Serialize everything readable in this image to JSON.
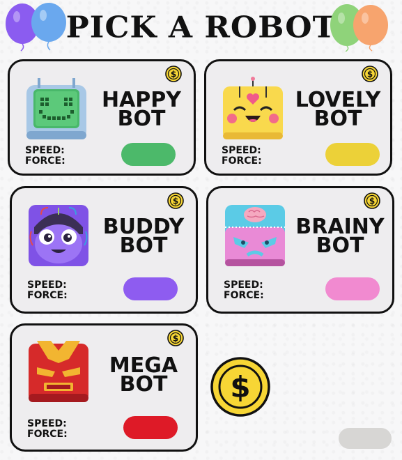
{
  "title": "PICK A ROBOT",
  "labels": {
    "speed": "SPEED:",
    "force": "FORCE:"
  },
  "robots": [
    {
      "line1": "HAPPY",
      "line2": "BOT",
      "color": "#4cb96a",
      "icon": "happy-bot-icon"
    },
    {
      "line1": "LOVELY",
      "line2": "BOT",
      "color": "#ecd138",
      "icon": "lovely-bot-icon"
    },
    {
      "line1": "BUDDY",
      "line2": "BOT",
      "color": "#8e5cf0",
      "icon": "buddy-bot-icon"
    },
    {
      "line1": "BRAINY",
      "line2": "BOT",
      "color": "#f18ad0",
      "icon": "brainy-bot-icon"
    },
    {
      "line1": "MEGA",
      "line2": "BOT",
      "color": "#de1a27",
      "icon": "mega-bot-icon"
    }
  ],
  "coin_symbol": "$",
  "colors": {
    "coin": "#f7d635",
    "balloon_purple": "#8b5cf0",
    "balloon_blue": "#6aa8ee",
    "balloon_green": "#8fd37a",
    "balloon_orange": "#f7a46e",
    "corner_pill": "#d7d6d4"
  }
}
